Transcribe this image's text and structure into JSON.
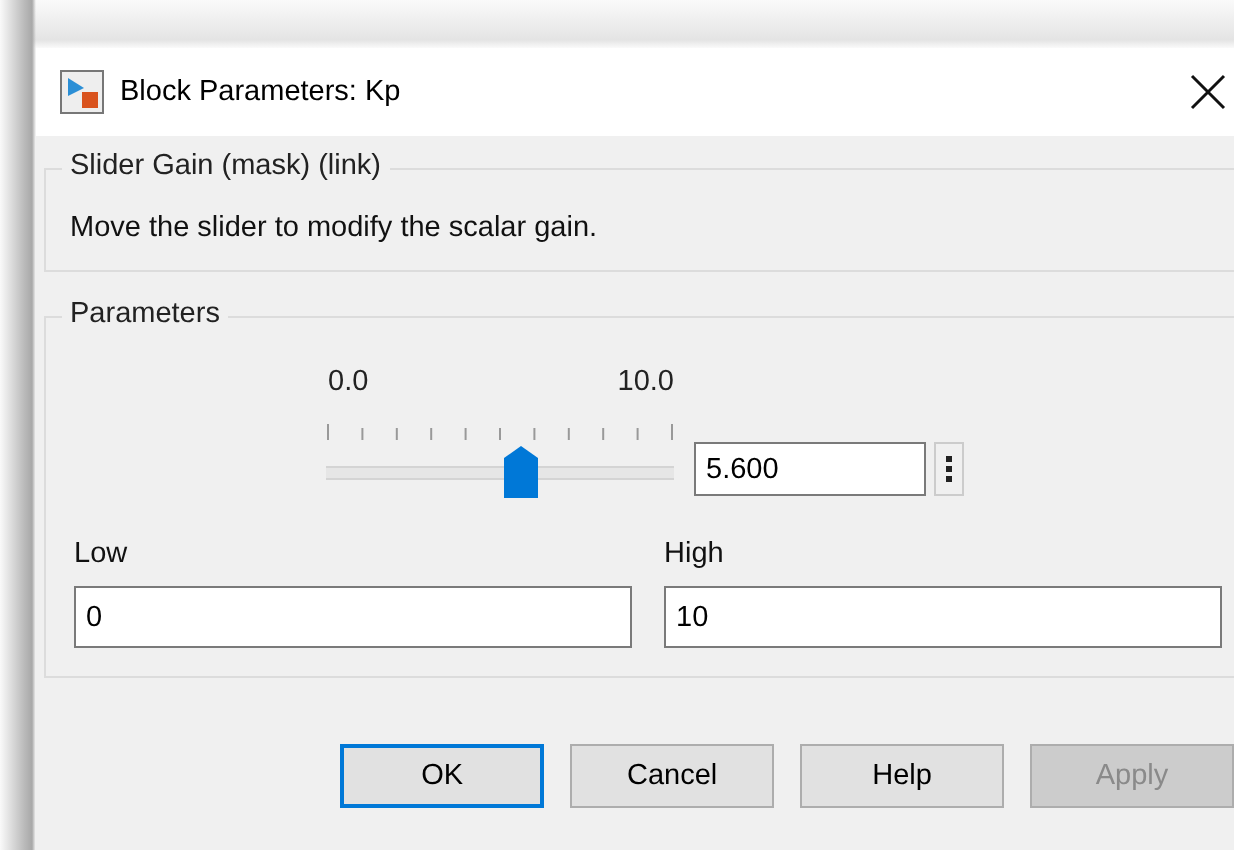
{
  "window": {
    "title": "Block Parameters: Kp"
  },
  "mask_group": {
    "title": "Slider Gain (mask) (link)",
    "description": "Move the slider to modify the scalar gain."
  },
  "parameters": {
    "title": "Parameters",
    "slider": {
      "min_label": "0.0",
      "max_label": "10.0",
      "level": 0.56,
      "value": "5.600"
    },
    "fields": [
      {
        "label": "Low",
        "value": "0"
      },
      {
        "label": "High",
        "value": "10"
      }
    ]
  },
  "buttons": [
    {
      "label": "OK",
      "default": true,
      "disabled": false
    },
    {
      "label": "Cancel",
      "default": false,
      "disabled": false
    },
    {
      "label": "Help",
      "default": false,
      "disabled": false
    },
    {
      "label": "Apply",
      "default": false,
      "disabled": true
    }
  ]
}
